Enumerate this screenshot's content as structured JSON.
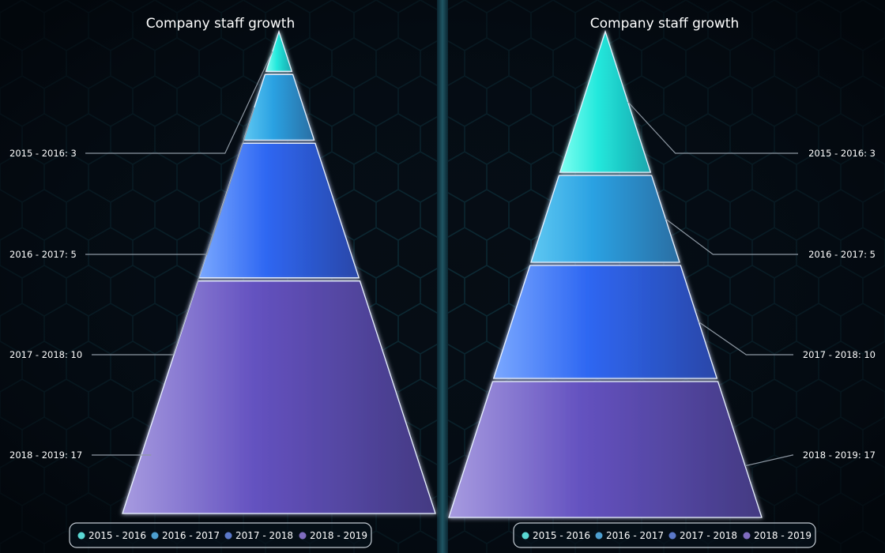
{
  "colors": {
    "background": "#050b12",
    "hex_pattern": "#0f3a45",
    "divider": "#1c4a55",
    "label_text": "#ffffff",
    "leader_line": "#8e98a3",
    "segments": [
      [
        "#7ffff0",
        "#22e8dc",
        "#1aa6ad"
      ],
      [
        "#5fc8f2",
        "#2aa1e2",
        "#2a6ea3"
      ],
      [
        "#7aa8ff",
        "#2e67f2",
        "#2a47a8"
      ],
      [
        "#a79be0",
        "#6452c0",
        "#433a82"
      ]
    ]
  },
  "chart_data": [
    {
      "type": "pyramid",
      "title": "Company staff growth",
      "labels_side": "left",
      "mode": "linear",
      "categories": [
        "2015 - 2016",
        "2016 - 2017",
        "2017 - 2018",
        "2018 - 2019"
      ],
      "values": [
        3,
        5,
        10,
        17
      ],
      "data_labels": [
        "2015 - 2016: 3",
        "2016 - 2017: 5",
        "2017 - 2018: 10",
        "2018 - 2019: 17"
      ],
      "legend": [
        "2015 - 2016",
        "2016 - 2017",
        "2017 - 2018",
        "2018 - 2019"
      ],
      "legend_position": "bottom-center"
    },
    {
      "type": "pyramid",
      "title": "Company staff growth",
      "labels_side": "right",
      "mode": "area",
      "categories": [
        "2015 - 2016",
        "2016 - 2017",
        "2017 - 2018",
        "2018 - 2019"
      ],
      "values": [
        3,
        5,
        10,
        17
      ],
      "data_labels": [
        "2015 - 2016: 3",
        "2016 - 2017: 5",
        "2017 - 2018: 10",
        "2018 - 2019: 17"
      ],
      "legend": [
        "2015 - 2016",
        "2016 - 2017",
        "2017 - 2018",
        "2018 - 2019"
      ],
      "legend_position": "bottom-center"
    }
  ]
}
